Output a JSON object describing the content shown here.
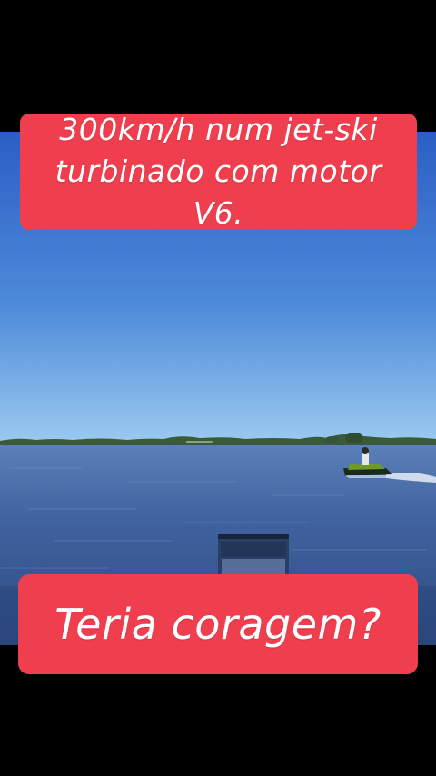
{
  "overlay": {
    "top_caption": "300km/h num jet-ski turbinado com motor V6.",
    "bottom_caption": "Teria coragem?"
  },
  "colors": {
    "caption_background": "#ef3e4e",
    "caption_text": "#ffffff",
    "letterbox": "#000000",
    "sky_top": "#2f63c6",
    "sky_bottom": "#8fc4ee",
    "water": "#3e5e9a"
  }
}
